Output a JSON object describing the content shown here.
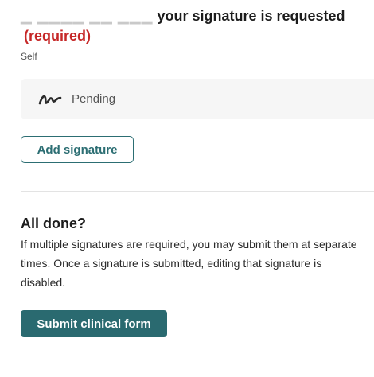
{
  "signature_section": {
    "redacted_prefix": "▁ ▁▁▁▁ ▁▁ ▁▁▁",
    "title_text": "your signature is requested",
    "required_label": "(required)",
    "signer": "Self",
    "status": "Pending",
    "status_icon": "signature-squiggle-icon",
    "add_button_label": "Add signature"
  },
  "completion": {
    "heading": "All done?",
    "body": "If multiple signatures are required, you may submit them at separate times. Once a signature is submitted, editing that signature is disabled.",
    "submit_label": "Submit clinical form"
  },
  "colors": {
    "accent": "#2a6a70",
    "required": "#c62828",
    "status_bg": "#f6f6f6"
  }
}
